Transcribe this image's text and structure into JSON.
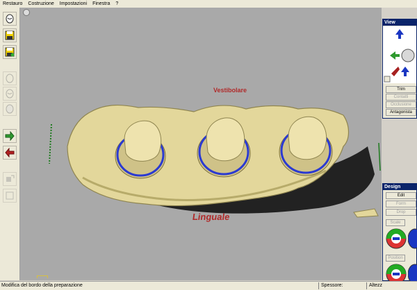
{
  "menu": [
    "Restauro",
    "Costruzione",
    "Impostazioni",
    "Finestra",
    "?"
  ],
  "toolbar": {
    "buttons": [
      "tooth-icon",
      "save-icon",
      "save-as-icon",
      "tooth-outline-icon",
      "tooth-outline-icon",
      "tooth-outline-icon",
      "next-arrow-icon",
      "back-arrow-icon",
      "cut-tool-icon",
      "disabled-tool-icon"
    ]
  },
  "viewport": {
    "label_top": "Vestibolare",
    "label_bottom": "Linguale",
    "model_color": "#e3d79b",
    "margin_line_color": "#2b3ad1"
  },
  "view_panel": {
    "title": "View",
    "trim_label": "Trim",
    "contact_label": "Contatti",
    "occlusion_label": "Occlusione",
    "antagonist_label": "Antagonista"
  },
  "design_panel": {
    "title": "Design",
    "edit_label": "Edit",
    "form_label": "Form",
    "drop_label": "Drop",
    "scale_label": "Scale",
    "position_label": "Position"
  },
  "status": {
    "message": "Modifica del bordo della preparazione",
    "thickness_label": "Spessore:",
    "height_label": "Altezz"
  }
}
